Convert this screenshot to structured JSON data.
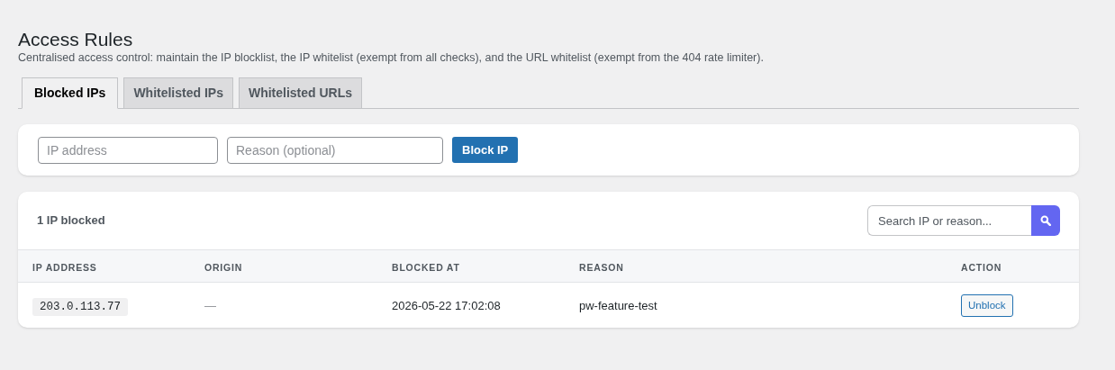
{
  "page": {
    "title": "Access Rules",
    "description": "Centralised access control: maintain the IP blocklist, the IP whitelist (exempt from all checks), and the URL whitelist (exempt from the 404 rate limiter)."
  },
  "tabs": [
    {
      "label": "Blocked IPs",
      "selected": true
    },
    {
      "label": "Whitelisted IPs",
      "selected": false
    },
    {
      "label": "Whitelisted URLs",
      "selected": false
    }
  ],
  "add_form": {
    "ip_field": {
      "placeholder": "IP address"
    },
    "reason_field": {
      "placeholder": "Reason (optional)"
    },
    "button": "Block IP"
  },
  "list": {
    "count": "1 IP blocked",
    "search": {
      "placeholder": "Search IP or reason..."
    },
    "table": {
      "columns": [
        "IP ADDRESS",
        "ORIGIN",
        "BLOCKED AT",
        "REASON",
        "ACTION"
      ],
      "rows": [
        {
          "ip": "203.0.113.77",
          "origin": "—",
          "blocked_at": "2026-05-22 17:02:08",
          "reason": "pw-feature-test",
          "action": "Unblock"
        }
      ]
    }
  }
}
